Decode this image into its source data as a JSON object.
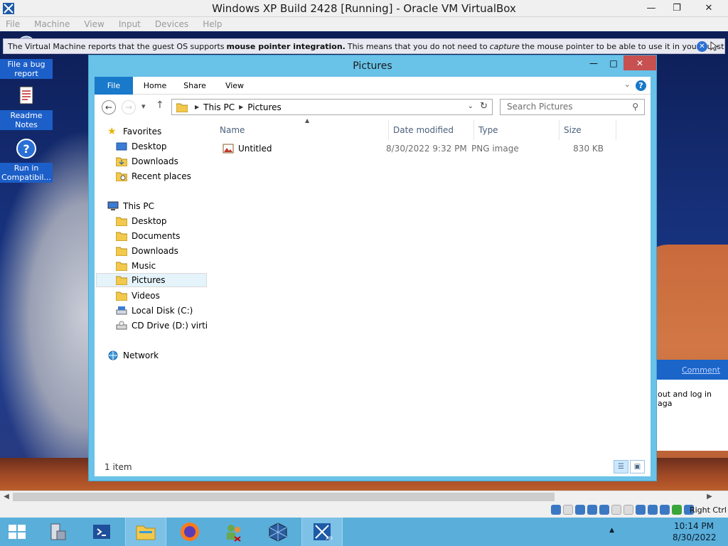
{
  "vbox": {
    "title": "Windows XP Build 2428 [Running] - Oracle VM VirtualBox",
    "menu": [
      "File",
      "Machine",
      "View",
      "Input",
      "Devices",
      "Help"
    ],
    "info_pre": "The Virtual Machine reports that the guest OS supports",
    "info_bold": "mouse pointer integration.",
    "info_mid": "This means that you do not need to",
    "info_italic": "capture",
    "info_post": "the mouse pointer to be able to use it in your guest OS -- all mouse",
    "host_key": "Right Ctrl"
  },
  "desktop": {
    "icons": [
      {
        "label": "File a bug report"
      },
      {
        "label": "Readme Notes"
      },
      {
        "label": "Run in Compatibil..."
      }
    ],
    "side_panel": {
      "link": "Comment",
      "text": "out and log in aga"
    }
  },
  "explorer": {
    "title": "Pictures",
    "ribbon_tabs": [
      "File",
      "Home",
      "Share",
      "View"
    ],
    "address": [
      "This PC",
      "Pictures"
    ],
    "search_placeholder": "Search Pictures",
    "tree": {
      "favorites": "Favorites",
      "fav_items": [
        "Desktop",
        "Downloads",
        "Recent places"
      ],
      "this_pc": "This PC",
      "pc_items": [
        "Desktop",
        "Documents",
        "Downloads",
        "Music",
        "Pictures",
        "Videos",
        "Local Disk (C:)",
        "CD Drive (D:) virtio-w"
      ],
      "network": "Network"
    },
    "columns": [
      "Name",
      "Date modified",
      "Type",
      "Size"
    ],
    "files": [
      {
        "name": "Untitled",
        "date": "8/30/2022 9:32 PM",
        "type": "PNG image",
        "size": "830 KB"
      }
    ],
    "status": "1 item"
  },
  "taskbar": {
    "time": "10:14 PM",
    "date": "8/30/2022"
  }
}
